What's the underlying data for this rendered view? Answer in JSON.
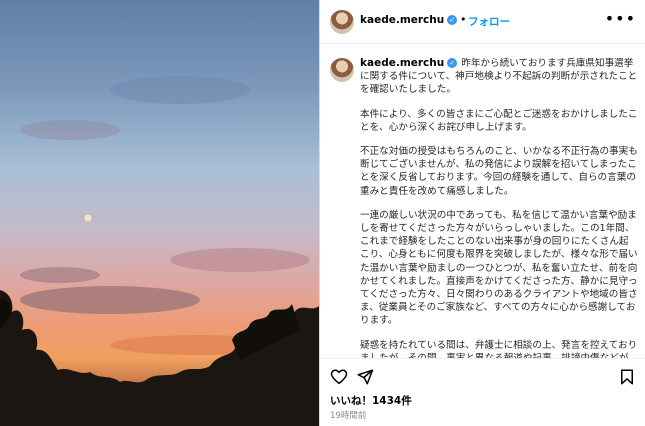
{
  "post": {
    "username": "kaede.merchu",
    "follow_label": "フォロー",
    "more_label": "•••",
    "caption_paragraphs": [
      "昨年から続いております兵庫県知事選挙に関する件について、神戸地検より不起訴の判断が示されたことを確認いたしました。",
      "本件により、多くの皆さまにご心配とご迷惑をおかけしましたことを、心から深くお詫び申し上げます。",
      "不正な対価の授受はもちろんのこと、いかなる不正行為の事実も断じてございませんが、私の発信により誤解を招いてしまったことを深く反省しております。今回の経験を通して、自らの言葉の重みと責任を改めて痛感しました。",
      "一連の厳しい状況の中であっても、私を信じて温かい言葉や励ましを寄せてくださった方々がいらっしゃいました。この1年間、これまで経験をしたことのない出来事が身の回りにたくさん起こり、心身ともに何度も限界を突破しましたが、様々な形で届いた温かい言葉や励ましの一つひとつが、私を奮い立たせ、前を向かせてくれました。直接声をかけてくださった方、静かに見守ってくださった方々、日々関わりのあるクライアントや地域の皆さま、従業員とそのご家族など、すべての方々に心から感謝しております。",
      "疑惑を持たれている間は、弁護士に相談の上、発言を控えておりましたが、その間、事実と異なる報道や記事、誹謗中傷などが数多く見られました。私自身は、この一年間、捜査等に協力をしながら、発生し続ける問題に一つひとつ真摯に向き合い、また、本"
    ],
    "likes_text": "いいね！1434件",
    "time_text": "19時間前"
  },
  "icons": {
    "heart": "heart-icon",
    "share": "send-icon",
    "bookmark": "bookmark-icon",
    "verified": "verified-badge-icon",
    "more": "more-options-icon"
  },
  "colors": {
    "accent": "#0095f6",
    "verified": "#3897f0",
    "muted": "#8e8e8e"
  }
}
